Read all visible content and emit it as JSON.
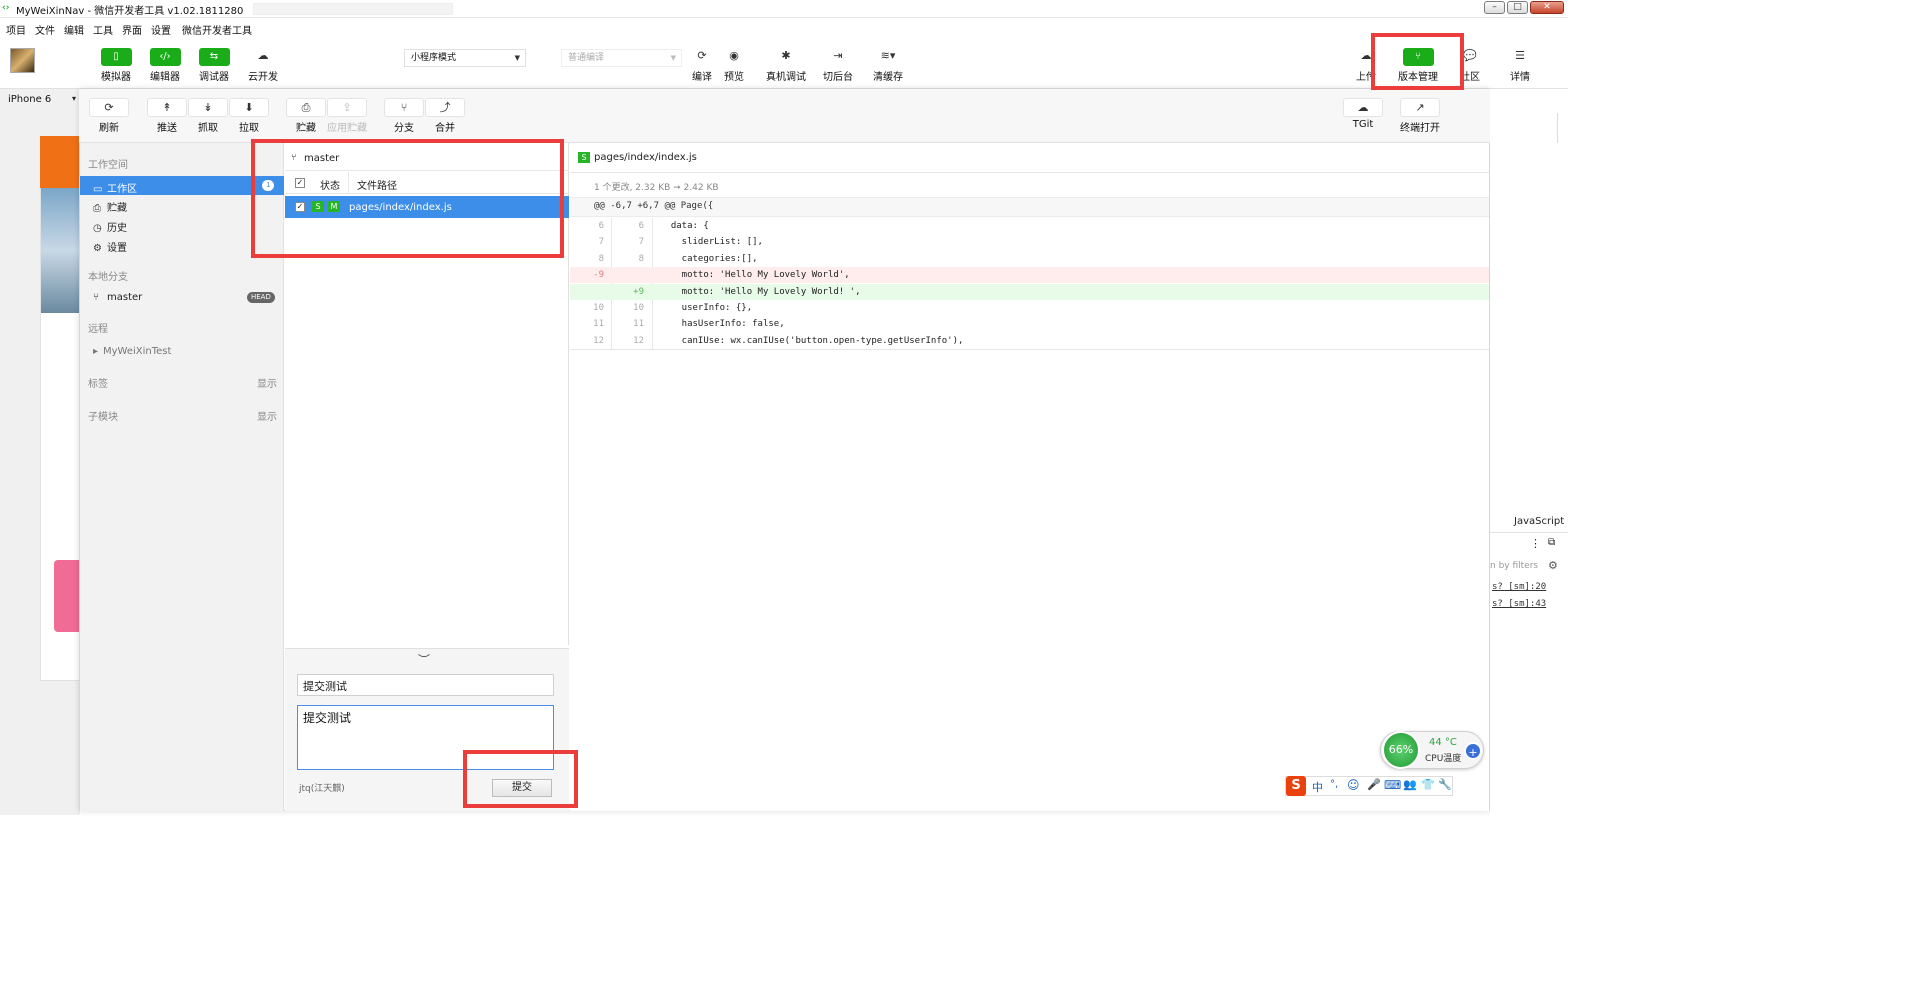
{
  "window": {
    "title": "MyWeiXinNav - 微信开发者工具 v1.02.1811280"
  },
  "menu": [
    "项目",
    "文件",
    "编辑",
    "工具",
    "界面",
    "设置",
    "微信开发者工具"
  ],
  "toolbar": {
    "left": [
      {
        "label": "模拟器",
        "icon": "phone-icon"
      },
      {
        "label": "编辑器",
        "icon": "code-icon"
      },
      {
        "label": "调试器",
        "icon": "debug-icon"
      },
      {
        "label": "云开发",
        "icon": "cloud-icon"
      }
    ],
    "mode": "小程序模式",
    "compile": "普通编译",
    "actions": [
      {
        "label": "编译",
        "icon": "refresh-icon"
      },
      {
        "label": "预览",
        "icon": "eye-icon"
      },
      {
        "label": "真机调试",
        "icon": "bug-icon"
      },
      {
        "label": "切后台",
        "icon": "switch-icon"
      },
      {
        "label": "清缓存",
        "icon": "layers-icon"
      }
    ],
    "right": [
      {
        "label": "上传",
        "icon": "upload-icon"
      },
      {
        "label": "版本管理",
        "icon": "branch-icon"
      },
      {
        "label": "社区",
        "icon": "community-icon"
      },
      {
        "label": "详情",
        "icon": "menu-icon"
      }
    ]
  },
  "device": "iPhone 6",
  "vc": {
    "toolbar": [
      {
        "label": "刷新",
        "icon": "refresh-icon"
      },
      {
        "label": "推送",
        "icon": "push-icon"
      },
      {
        "label": "抓取",
        "icon": "fetch-icon"
      },
      {
        "label": "拉取",
        "icon": "pull-icon"
      },
      {
        "label": "贮藏",
        "icon": "stash-icon"
      },
      {
        "label": "应用贮藏",
        "icon": "apply-stash-icon"
      },
      {
        "label": "分支",
        "icon": "branch-icon"
      },
      {
        "label": "合并",
        "icon": "merge-icon"
      }
    ],
    "toolbar_right": [
      {
        "label": "TGit",
        "icon": "tgit-icon"
      },
      {
        "label": "终端打开",
        "icon": "external-icon"
      }
    ],
    "nav": {
      "workspace_header": "工作空间",
      "workspace": [
        {
          "label": "工作区",
          "badge": "1"
        },
        {
          "label": "贮藏"
        },
        {
          "label": "历史"
        },
        {
          "label": "设置"
        }
      ],
      "local_header": "本地分支",
      "branch": "master",
      "branch_badge": "HEAD",
      "remote_header": "远程",
      "remote": "MyWeiXinTest",
      "tags_header": "标签",
      "tags_action": "显示",
      "sub_header": "子模块",
      "sub_action": "显示"
    },
    "files": {
      "branch": "master",
      "col_status": "状态",
      "col_path": "文件路径",
      "rows": [
        {
          "tag1": "S",
          "tag2": "M",
          "path": "pages/index/index.js"
        }
      ]
    },
    "commit": {
      "title": "提交测试",
      "message": "提交测试",
      "author": "jtq(江天麒)",
      "button": "提交"
    },
    "diff": {
      "file": "pages/index/index.js",
      "summary": "1 个更改, 2.32 KB ➞ 2.42 KB",
      "hunk": "@@ -6,7 +6,7 @@ Page({",
      "lines": [
        {
          "a": "6",
          "b": "6",
          "t": "  data: {",
          "k": ""
        },
        {
          "a": "7",
          "b": "7",
          "t": "    sliderList: [],",
          "k": ""
        },
        {
          "a": "8",
          "b": "8",
          "t": "    categories:[],",
          "k": ""
        },
        {
          "a": "-9",
          "b": "",
          "t": "    motto: 'Hello My Lovely World',",
          "k": "del"
        },
        {
          "a": "",
          "b": "+9",
          "t": "    motto: 'Hello My Lovely World! ',",
          "k": "add"
        },
        {
          "a": "10",
          "b": "10",
          "t": "    userInfo: {},",
          "k": ""
        },
        {
          "a": "11",
          "b": "11",
          "t": "    hasUserInfo: false,",
          "k": ""
        },
        {
          "a": "12",
          "b": "12",
          "t": "    canIUse: wx.canIUse('button.open-type.getUserInfo'),",
          "k": ""
        }
      ]
    }
  },
  "right_panel": {
    "lang": "JavaScript",
    "filter": "n by filters",
    "link1": "s? [sm]:20",
    "link2": "s? [sm]:43"
  },
  "cpu": {
    "percent": "66%",
    "temp": "44 °C",
    "label": "CPU温度"
  },
  "ime": "中",
  "colors": {
    "accent": "#1aad19",
    "selection": "#3d8ee8",
    "highlight": "#ec3d3d"
  }
}
